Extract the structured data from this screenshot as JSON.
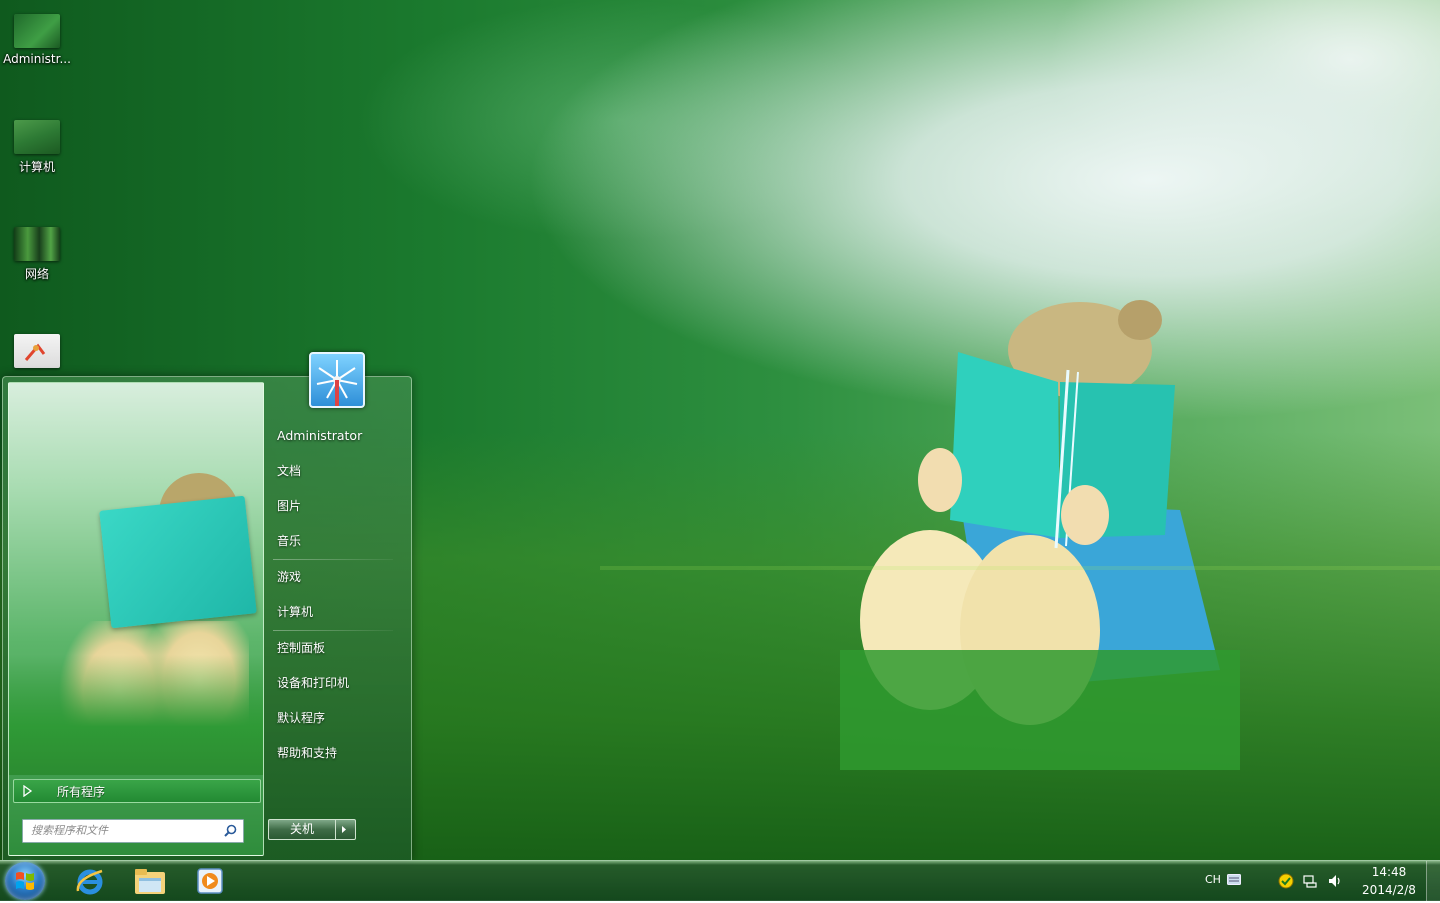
{
  "desktop": {
    "icons": [
      {
        "label": "Administr..."
      },
      {
        "label": "计算机"
      },
      {
        "label": "网络"
      },
      {
        "label": ""
      }
    ]
  },
  "start_menu": {
    "user_name": "Administrator",
    "items": [
      "文档",
      "图片",
      "音乐",
      "游戏",
      "计算机",
      "控制面板",
      "设备和打印机",
      "默认程序",
      "帮助和支持"
    ],
    "all_programs": "所有程序",
    "search_placeholder": "搜索程序和文件",
    "shutdown_label": "关机"
  },
  "taskbar": {
    "language": "CH",
    "time": "14:48",
    "date": "2014/2/8",
    "pinned": [
      "internet-explorer",
      "windows-explorer",
      "media-player"
    ]
  },
  "colors": {
    "accent_green": "#2e9040",
    "taskbar_bg": "#1c5a28"
  }
}
